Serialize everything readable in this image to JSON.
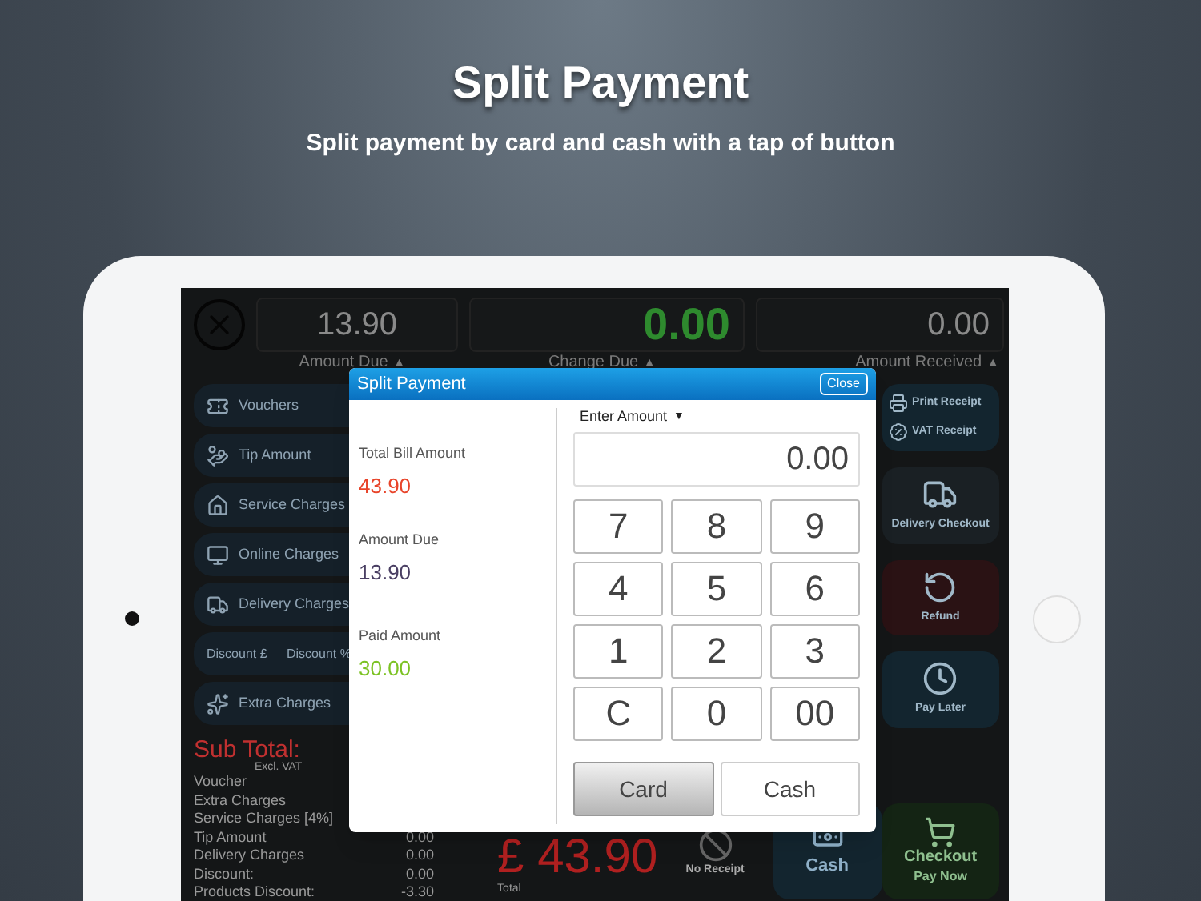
{
  "hero": {
    "title": "Split Payment",
    "subtitle": "Split payment by card and cash with a tap of button"
  },
  "pos": {
    "header": [
      {
        "value": "13.90",
        "label": "Amount Due",
        "caret": "▲",
        "color": "#8a8a8a"
      },
      {
        "value": "0.00",
        "label": "Change Due",
        "caret": "▲",
        "color": "#2e8a2e"
      },
      {
        "value": "0.00",
        "label": "Amount Received",
        "caret": "▲",
        "color": "#8a8a8a"
      }
    ],
    "left_buttons": [
      {
        "kind": "single",
        "labels": [
          "Vouchers"
        ]
      },
      {
        "kind": "single",
        "labels": [
          "Tip Amount"
        ]
      },
      {
        "kind": "single",
        "labels": [
          "Service Charges"
        ]
      },
      {
        "kind": "single",
        "labels": [
          "Online Charges"
        ]
      },
      {
        "kind": "single",
        "labels": [
          "Delivery Charges"
        ]
      },
      {
        "kind": "double",
        "labels": [
          "Discount £",
          "Discount %"
        ]
      },
      {
        "kind": "single",
        "labels": [
          "Extra Charges"
        ]
      }
    ],
    "subtotal": {
      "label": "Sub Total:",
      "note": "Excl. VAT"
    },
    "summary": [
      {
        "label": "Voucher"
      },
      {
        "label": "Extra Charges"
      },
      {
        "label": "Service Charges [4%]"
      },
      {
        "label": "Tip Amount",
        "value": "0.00"
      },
      {
        "label": "Delivery Charges",
        "value": "0.00"
      },
      {
        "label": "Discount:",
        "value": "0.00"
      },
      {
        "label": "Products Discount:",
        "value": "-3.30"
      }
    ],
    "total": {
      "amount": "£ 43.90",
      "caption": "Total"
    },
    "no_receipt": "No Receipt",
    "right_buttons": [
      {
        "labels": [
          "Print Receipt",
          "VAT Receipt"
        ],
        "color": "#13252f"
      },
      {
        "labels": [
          "Delivery Checkout"
        ],
        "color": "#1a2024"
      },
      {
        "labels": [
          "Refund"
        ],
        "color": "#2a1214"
      },
      {
        "labels": [
          "Pay Later"
        ],
        "color": "#13252f"
      }
    ],
    "cash_button": {
      "label": "Cash"
    },
    "checkout_button": {
      "label": "Checkout",
      "sublabel": "Pay Now"
    }
  },
  "dialog": {
    "title": "Split Payment",
    "close": "Close",
    "amounts": [
      {
        "label": "Total Bill Amount",
        "value": "43.90",
        "color": "#e8442a"
      },
      {
        "label": "Amount Due",
        "value": "13.90",
        "color": "#4a3f63"
      },
      {
        "label": "Paid Amount",
        "value": "30.00",
        "color": "#7cc224"
      }
    ],
    "amount_menu": {
      "label": "Enter Amount",
      "caret": "▼"
    },
    "amount_field": {
      "value": "0.00"
    },
    "keys": [
      "7",
      "8",
      "9",
      "4",
      "5",
      "6",
      "1",
      "2",
      "3",
      "C",
      "0",
      "00"
    ],
    "methods": [
      {
        "label": "Card",
        "selected": true
      },
      {
        "label": "Cash",
        "selected": false
      }
    ]
  }
}
